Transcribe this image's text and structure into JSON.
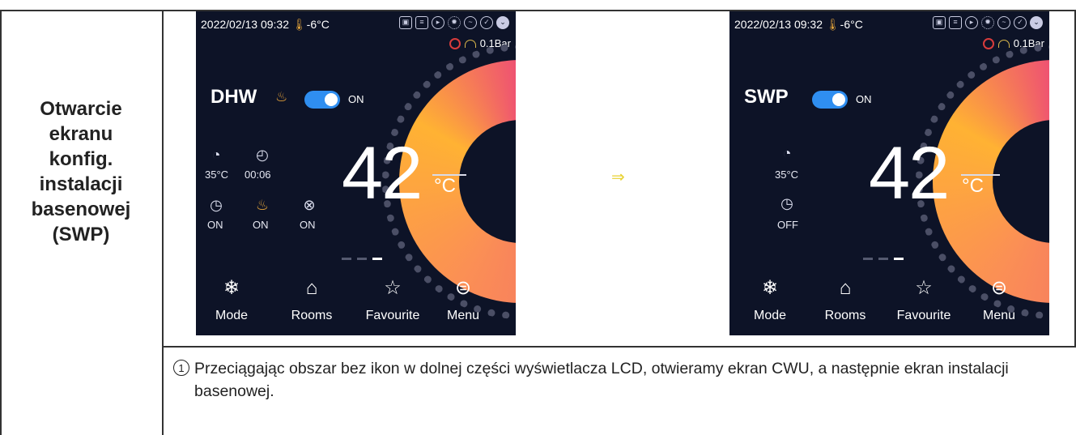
{
  "left_cell": {
    "title": "Otwarcie\nekranu\nkonfig.\ninstalacji\nbasenowej\n(SWP)"
  },
  "screens": [
    {
      "status": {
        "datetime": "2022/02/13  09:32",
        "outdoor_temp": "-6°C",
        "pressure": "0.1Bar"
      },
      "mode": {
        "name": "DHW",
        "toggle_label": "ON"
      },
      "setpoint": {
        "value": "42",
        "unit": "°C"
      },
      "sub_items": [
        {
          "icon": "water-temp-gauge-icon",
          "label": "35°C"
        },
        {
          "icon": "timer-icon",
          "label": "00:06"
        },
        {
          "icon": "schedule-7x24-icon",
          "label": "ON"
        },
        {
          "icon": "disinfect-icon",
          "label": "ON"
        },
        {
          "icon": "fan-off-icon",
          "label": "ON"
        }
      ],
      "nav": [
        {
          "icon": "mode-snowflake-sun-icon",
          "label": "Mode"
        },
        {
          "icon": "home-icon",
          "label": "Rooms"
        },
        {
          "icon": "star-icon",
          "label": "Favourite"
        },
        {
          "icon": "menu-list-icon",
          "label": "Menu"
        }
      ]
    },
    {
      "status": {
        "datetime": "2022/02/13  09:32",
        "outdoor_temp": "-6°C",
        "pressure": "0.1Bar"
      },
      "mode": {
        "name": "SWP",
        "toggle_label": "ON"
      },
      "setpoint": {
        "value": "42",
        "unit": "°C"
      },
      "sub_items": [
        {
          "icon": "water-temp-gauge-icon",
          "label": "35°C"
        },
        {
          "icon": "schedule-7x24-icon",
          "label": "OFF"
        }
      ],
      "nav": [
        {
          "icon": "mode-snowflake-sun-icon",
          "label": "Mode"
        },
        {
          "icon": "home-icon",
          "label": "Rooms"
        },
        {
          "icon": "star-icon",
          "label": "Favourite"
        },
        {
          "icon": "menu-list-icon",
          "label": "Menu"
        }
      ]
    }
  ],
  "note": {
    "number": "1",
    "text": "Przeciągając obszar bez ikon w dolnej części wyświetlacza LCD, otwieramy ekran CWU, a następnie ekran instalacji basenowej."
  },
  "colors": {
    "screen_bg": "#0d1327",
    "toggle": "#2f8ef0",
    "ring_start": "#ee4f74",
    "ring_end": "#ffb233",
    "arrow": "#e8d233"
  }
}
